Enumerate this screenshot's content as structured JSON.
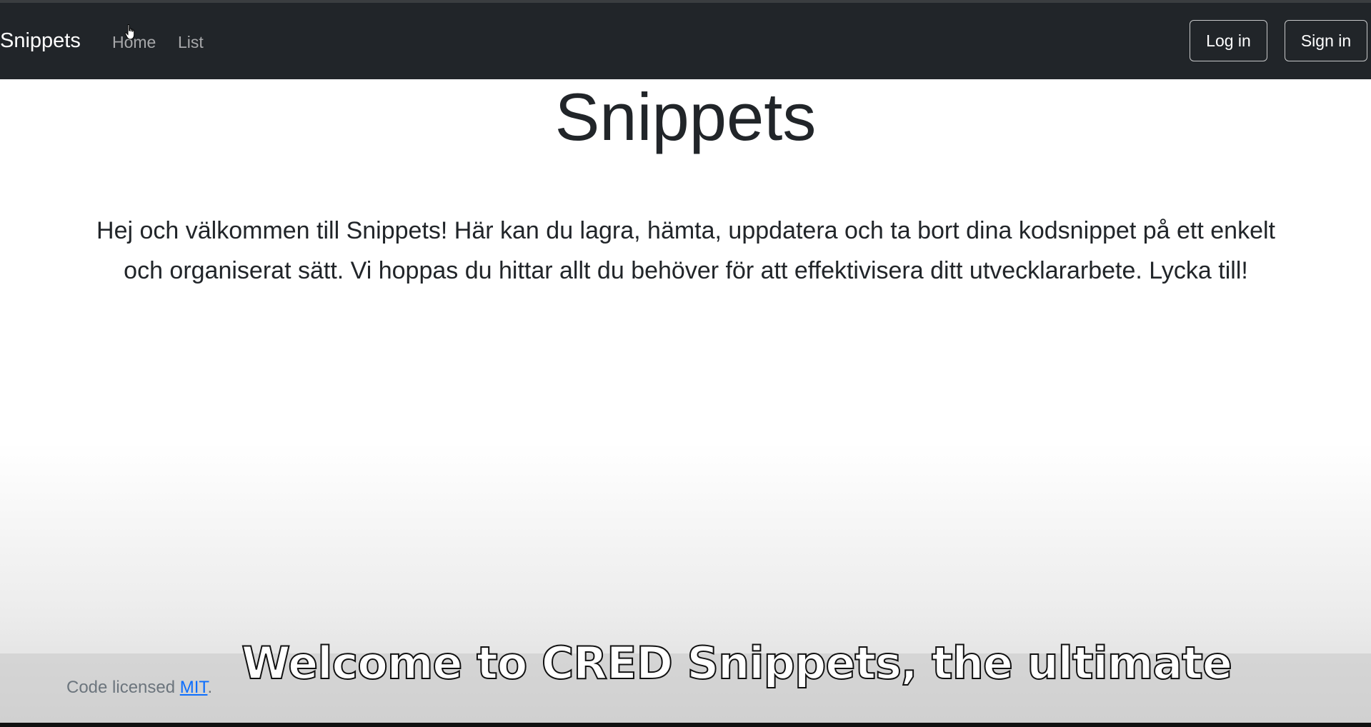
{
  "navbar": {
    "brand": "Snippets",
    "links": [
      {
        "label": "Home"
      },
      {
        "label": "List"
      }
    ],
    "login_label": "Log in",
    "signin_label": "Sign in"
  },
  "main": {
    "title": "Snippets",
    "intro": "Hej och välkommen till Snippets! Här kan du lagra, hämta, uppdatera och ta bort dina kodsnippet på ett enkelt och organiserat sätt. Vi hoppas du hittar allt du behöver för att effektivisera ditt utvecklararbete. Lycka till!"
  },
  "footer": {
    "text": "Code licensed ",
    "link_label": "MIT",
    "suffix": "."
  },
  "caption": {
    "text": "Welcome to CRED Snippets, the ultimate"
  },
  "colors": {
    "navbar_bg": "#212529",
    "link": "#0d6efd",
    "text": "#212529"
  }
}
